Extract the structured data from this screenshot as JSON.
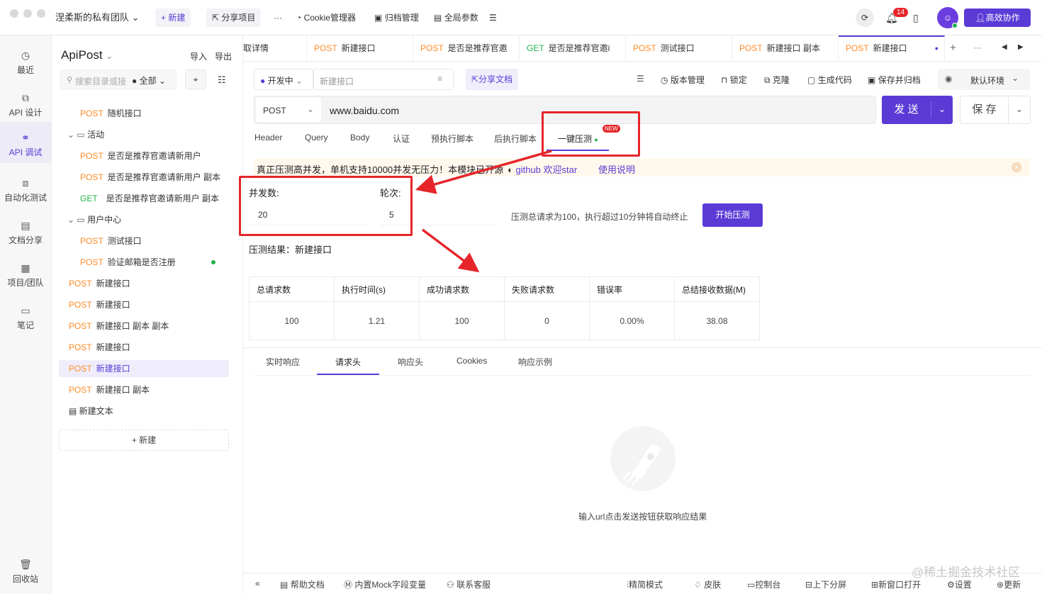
{
  "topbar": {
    "team_name": "涅柔斯的私有团队",
    "new_label": "+ 新建",
    "share_project": "分享项目",
    "more": "···",
    "cookie_manager": "Cookie管理器",
    "archive_manager": "归档管理",
    "global_params": "全局参数",
    "notification_count": "14",
    "collab_button": "高效协作"
  },
  "leftnav": {
    "items": [
      {
        "label": "最近",
        "icon": "clock-icon"
      },
      {
        "label": "API 设计",
        "icon": "api-design-icon"
      },
      {
        "label": "API 调试",
        "icon": "api-debug-icon"
      },
      {
        "label": "自动化测试",
        "icon": "automation-icon"
      },
      {
        "label": "文档分享",
        "icon": "document-icon"
      },
      {
        "label": "项目/团队",
        "icon": "project-icon"
      },
      {
        "label": "笔记",
        "icon": "note-icon"
      }
    ],
    "trash": "回收站"
  },
  "tree": {
    "app_name": "ApiPost",
    "import": "导入",
    "export": "导出",
    "search_placeholder": "搜索目录或接口",
    "filter_all": "全部",
    "new_button": "+ 新建",
    "rows": [
      {
        "method": "POST",
        "name": "随机接口"
      },
      {
        "method": "",
        "name": "活动"
      },
      {
        "method": "POST",
        "name": "是否是推荐官邀请新用户"
      },
      {
        "method": "POST",
        "name": "是否是推荐官邀请新用户 副本"
      },
      {
        "method": "GET",
        "name": "是否是推荐官邀请新用户 副本"
      },
      {
        "method": "",
        "name": "用户中心"
      },
      {
        "method": "POST",
        "name": "测试接口"
      },
      {
        "method": "POST",
        "name": "验证邮箱是否注册"
      },
      {
        "method": "POST",
        "name": "新建接口"
      },
      {
        "method": "POST",
        "name": "新建接口"
      },
      {
        "method": "POST",
        "name": "新建接口 副本 副本"
      },
      {
        "method": "POST",
        "name": "新建接口"
      },
      {
        "method": "POST",
        "name": "新建接口"
      },
      {
        "method": "POST",
        "name": "新建接口 副本"
      },
      {
        "method": "",
        "name": "新建文本"
      }
    ]
  },
  "tabs": [
    {
      "method": "",
      "name": "取详情"
    },
    {
      "method": "POST",
      "name": "新建接口"
    },
    {
      "method": "POST",
      "name": "是否是推荐官邀"
    },
    {
      "method": "GET",
      "name": "是否是推荐官邀i"
    },
    {
      "method": "POST",
      "name": "测试接口"
    },
    {
      "method": "POST",
      "name": "新建接口 副本"
    },
    {
      "method": "POST",
      "name": "新建接口"
    }
  ],
  "request": {
    "status": "开发中",
    "name_placeholder": "新建接口",
    "share_doc": "分享文档",
    "version_mgmt": "版本管理",
    "lock": "锁定",
    "clone": "克隆",
    "gen_code": "生成代码",
    "save_archive": "保存并归档",
    "env": "默认环境",
    "method": "POST",
    "url": "www.baidu.com",
    "send": "发 送",
    "save": "保 存"
  },
  "subtabs": [
    "Header",
    "Query",
    "Body",
    "认证",
    "预执行脚本",
    "后执行脚本",
    "一键压测"
  ],
  "new_badge": "NEW",
  "banner": {
    "text": "真正压测高并发，单机支持10000并发无压力！本模块已开源",
    "github": "github 欢迎star",
    "usage": "使用说明"
  },
  "stress": {
    "concurrency_label": "并发数:",
    "rounds_label": "轮次:",
    "concurrency": "20",
    "rounds": "5",
    "hint": "压测总请求为100，执行超过10分钟将自动终止",
    "start": "开始压测",
    "result_title": "压测结果：新建接口"
  },
  "results": {
    "headers": [
      "总请求数",
      "执行时间(s)",
      "成功请求数",
      "失败请求数",
      "错误率",
      "总结接收数据(M)"
    ],
    "values": [
      "100",
      "1.21",
      "100",
      "0",
      "0.00%",
      "38.08"
    ]
  },
  "response_tabs": [
    "实时响应",
    "请求头",
    "响应头",
    "Cookies",
    "响应示例"
  ],
  "empty_text": "输入url点击发送按钮获取响应结果",
  "bottombar": {
    "help": "帮助文档",
    "mock": "内置Mock字段变量",
    "contact": "联系客服",
    "simple": "精简模式",
    "skin": "皮肤",
    "console": "控制台",
    "split": "上下分屏",
    "new_window": "新窗口打开",
    "settings": "设置",
    "update": "更新"
  },
  "watermark": "@稀土掘金技术社区",
  "colors": {
    "accent": "#5b3bd6",
    "post": "#ff8a25",
    "get": "#21b04b",
    "annotation": "#e5252a"
  }
}
